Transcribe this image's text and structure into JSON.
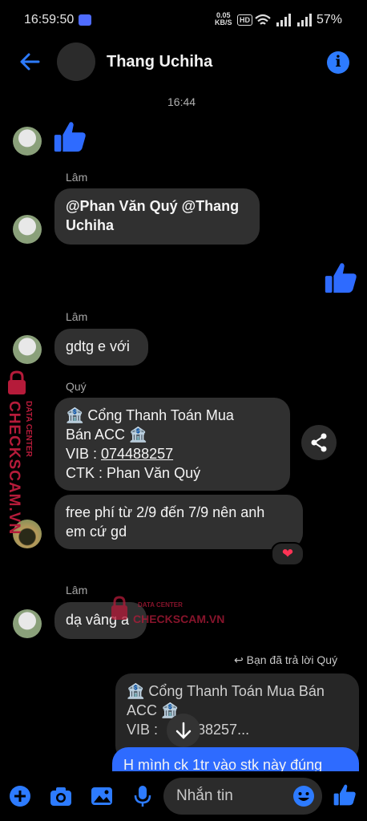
{
  "status_bar": {
    "time": "16:59:50",
    "net_speed_top": "0.05",
    "net_speed_unit": "KB/S",
    "hd": "HD",
    "battery": "57%"
  },
  "header": {
    "name": "Thang Uchiha"
  },
  "messages": {
    "timestamp": "16:44",
    "sender_lam_1": "Lâm",
    "mention_line1": "@Phan Văn Quý @Thang",
    "mention_line2": "Uchiha",
    "sender_lam_2": "Lâm",
    "gdtg": "gdtg e với",
    "sender_quy": "Quý",
    "payment_line1": "🏦 Cổng Thanh Toán Mua",
    "payment_line2": "Bán ACC 🏦",
    "payment_vib_label": "VIB : ",
    "payment_vib_number": "074488257",
    "payment_ctk": "CTK : Phan Văn Quý",
    "free_line1": "free phí từ 2/9 đến 7/9 nên anh",
    "free_line2": "em cứ gd",
    "reaction": "❤",
    "sender_lam_3": "Lâm",
    "da_vang": "dạ vâng a",
    "reply_label": "Bạn đã trả lời Quý",
    "quoted_line1": "🏦 Cổng Thanh Toán Mua Bán",
    "quoted_line2": "ACC 🏦",
    "quoted_line3": "VIB : ",
    "quoted_line3_b": "88257...",
    "outgoing_partial": "H mình ck 1tr vào stk này đúng"
  },
  "watermark": {
    "side_small": "DATA CENTER",
    "side_big": "CHECKSCAM.VN",
    "center_small": "DATA CENTER",
    "center_big": "CHECKSCAM.VN"
  },
  "composer": {
    "placeholder": "Nhắn tin"
  },
  "colors": {
    "accent": "#2d7bff",
    "bubble_in": "#303030",
    "bubble_out": "#2e6bff",
    "watermark": "#b51b3a"
  }
}
